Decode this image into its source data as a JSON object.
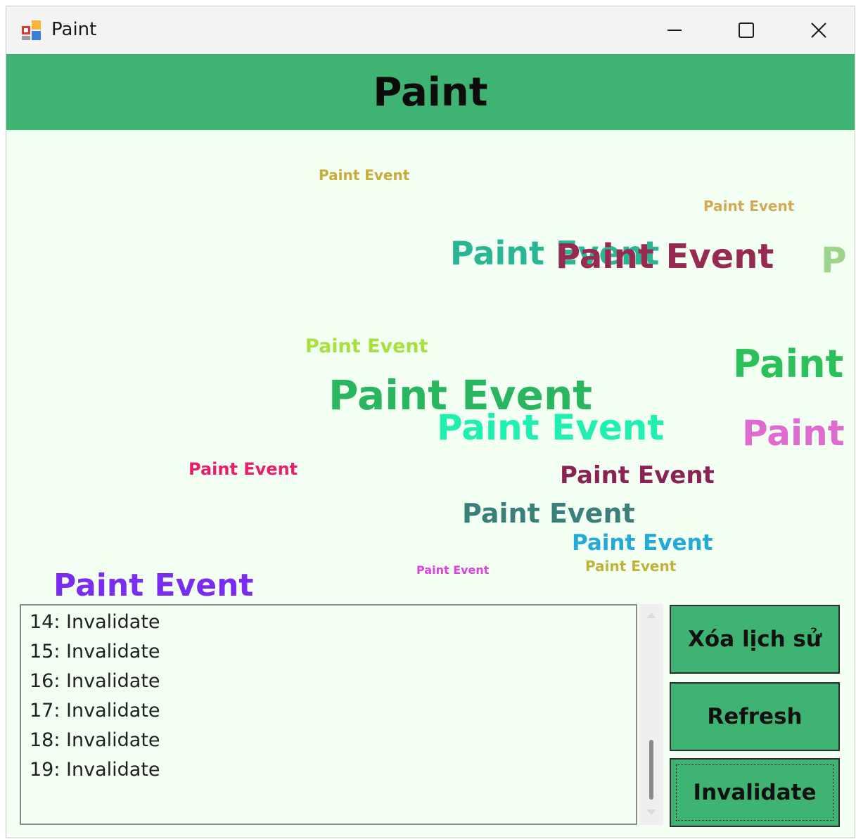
{
  "window": {
    "title": "Paint",
    "icon": "paint-app-icon",
    "controls": {
      "minimize": "minimize-icon",
      "maximize": "maximize-icon",
      "close": "close-icon"
    }
  },
  "header": {
    "title": "Paint"
  },
  "canvas": {
    "items": [
      {
        "text": "Paint Event",
        "color": "#c7ad3a"
      },
      {
        "text": "Paint Event",
        "color": "#d2aa55"
      },
      {
        "text": "Paint Event",
        "color": "#2ab595"
      },
      {
        "text": "Paint Event",
        "color": "#972a50"
      },
      {
        "text": "P",
        "color": "#9ed38a"
      },
      {
        "text": "Paint Event",
        "color": "#a5e03c"
      },
      {
        "text": "Paint",
        "color": "#2bc05a"
      },
      {
        "text": "Paint Event",
        "color": "#2ab560"
      },
      {
        "text": "Paint Event",
        "color": "#1ff0b0"
      },
      {
        "text": "Paint",
        "color": "#e06bd0"
      },
      {
        "text": "Paint Event",
        "color": "#ea1d6a"
      },
      {
        "text": "Paint Event",
        "color": "#8a2253"
      },
      {
        "text": "Paint Event",
        "color": "#3b7f7a"
      },
      {
        "text": "Paint Event",
        "color": "#25a9d6"
      },
      {
        "text": "Paint Event",
        "color": "#e040e0"
      },
      {
        "text": "Paint Event",
        "color": "#c0b23a"
      },
      {
        "text": "Paint Event",
        "color": "#7a2cf0"
      }
    ]
  },
  "log": {
    "lines": [
      "14: Invalidate",
      "15: Invalidate",
      "16: Invalidate",
      "17: Invalidate",
      "18: Invalidate",
      "19: Invalidate"
    ]
  },
  "buttons": {
    "clear_history": "Xóa lịch sử",
    "refresh": "Refresh",
    "invalidate": "Invalidate"
  },
  "colors": {
    "accent": "#3eb372",
    "background": "#f3fff3"
  }
}
